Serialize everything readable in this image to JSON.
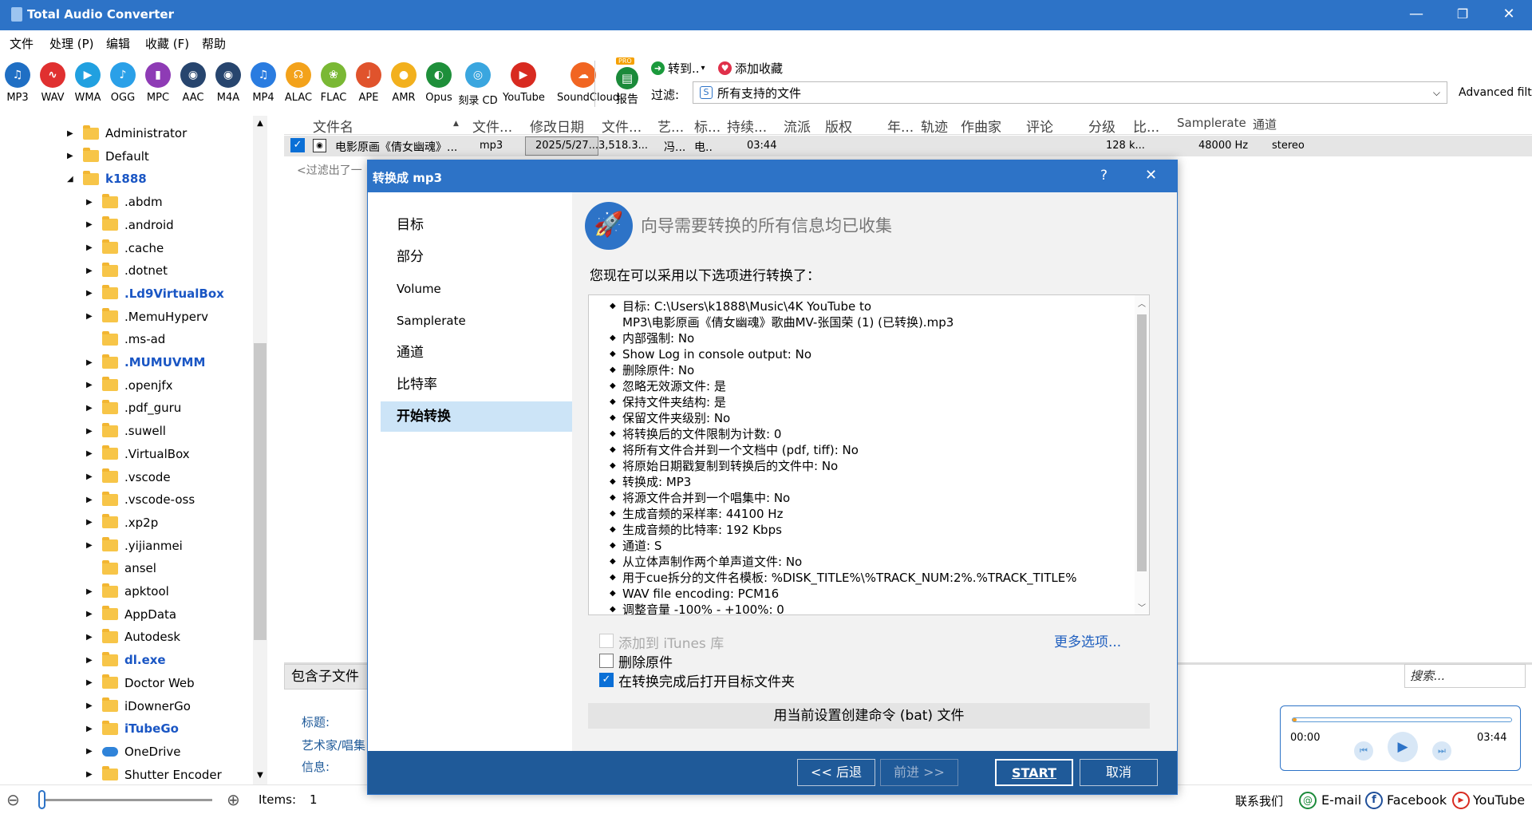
{
  "window": {
    "title": "Total Audio Converter",
    "minimize_glyph": "—",
    "restore_glyph": "❐",
    "close_glyph": "✕"
  },
  "menu": [
    "文件",
    "处理 (P)",
    "编辑",
    "收藏 (F)",
    "帮助"
  ],
  "formats": [
    {
      "label": "MP3",
      "color": "#1f6fc4",
      "glyph": "♫"
    },
    {
      "label": "WAV",
      "color": "#e03030",
      "glyph": "∿"
    },
    {
      "label": "WMA",
      "color": "#21a0e0",
      "glyph": "▶"
    },
    {
      "label": "OGG",
      "color": "#2aa0e8",
      "glyph": "♪"
    },
    {
      "label": "MPC",
      "color": "#8e3bb5",
      "glyph": "▮"
    },
    {
      "label": "AAC",
      "color": "#27456e",
      "glyph": "◉"
    },
    {
      "label": "M4A",
      "color": "#27456e",
      "glyph": "◉"
    },
    {
      "label": "MP4",
      "color": "#2a7ce0",
      "glyph": "♫"
    },
    {
      "label": "ALAC",
      "color": "#f3a21b",
      "glyph": "☊"
    },
    {
      "label": "FLAC",
      "color": "#7ab834",
      "glyph": "❀"
    },
    {
      "label": "APE",
      "color": "#e0532c",
      "glyph": "♩"
    },
    {
      "label": "AMR",
      "color": "#f2b01d",
      "glyph": "●"
    },
    {
      "label": "Opus",
      "color": "#1e8f3a",
      "glyph": "◐"
    },
    {
      "label": "刻录 CD",
      "color": "#3aa6df",
      "glyph": "◎"
    },
    {
      "label": "YouTube",
      "color": "#d82a20",
      "glyph": "▶"
    },
    {
      "label": "SoundCloud",
      "color": "#f16522",
      "glyph": "☁"
    }
  ],
  "toolbar": {
    "report": "报告",
    "pro_badge": "PRO",
    "convert_to": "转到..",
    "convert_arrow": "▾",
    "add_favorite": "添加收藏",
    "filter_label": "过滤:",
    "filter_value": "所有支持的文件",
    "advanced_filter": "Advanced filter"
  },
  "tree": {
    "scroll_up": "▲",
    "scroll_down": "▼",
    "items": [
      {
        "name": "Administrator",
        "level": 1,
        "expandable": true,
        "bold": false
      },
      {
        "name": "Default",
        "level": 1,
        "expandable": true,
        "bold": false
      },
      {
        "name": "k1888",
        "level": 1,
        "expandable": true,
        "expanded": true,
        "bold": true
      },
      {
        "name": ".abdm",
        "level": 2,
        "expandable": true
      },
      {
        "name": ".android",
        "level": 2,
        "expandable": true
      },
      {
        "name": ".cache",
        "level": 2,
        "expandable": true
      },
      {
        "name": ".dotnet",
        "level": 2,
        "expandable": true
      },
      {
        "name": ".Ld9VirtualBox",
        "level": 2,
        "expandable": true,
        "bold": true
      },
      {
        "name": ".MemuHyperv",
        "level": 2,
        "expandable": true
      },
      {
        "name": ".ms-ad",
        "level": 2,
        "expandable": false
      },
      {
        "name": ".MUMUVMM",
        "level": 2,
        "expandable": true,
        "bold": true
      },
      {
        "name": ".openjfx",
        "level": 2,
        "expandable": true
      },
      {
        "name": ".pdf_guru",
        "level": 2,
        "expandable": true
      },
      {
        "name": ".suwell",
        "level": 2,
        "expandable": true
      },
      {
        "name": ".VirtualBox",
        "level": 2,
        "expandable": true
      },
      {
        "name": ".vscode",
        "level": 2,
        "expandable": true
      },
      {
        "name": ".vscode-oss",
        "level": 2,
        "expandable": true
      },
      {
        "name": ".xp2p",
        "level": 2,
        "expandable": true
      },
      {
        "name": ".yijianmei",
        "level": 2,
        "expandable": true
      },
      {
        "name": "ansel",
        "level": 2,
        "expandable": false
      },
      {
        "name": "apktool",
        "level": 2,
        "expandable": true
      },
      {
        "name": "AppData",
        "level": 2,
        "expandable": true
      },
      {
        "name": "Autodesk",
        "level": 2,
        "expandable": true
      },
      {
        "name": "dl.exe",
        "level": 2,
        "expandable": true,
        "bold": true
      },
      {
        "name": "Doctor Web",
        "level": 2,
        "expandable": true
      },
      {
        "name": "iDownerGo",
        "level": 2,
        "expandable": true
      },
      {
        "name": "iTubeGo",
        "level": 2,
        "expandable": true,
        "bold": true
      },
      {
        "name": "OneDrive",
        "level": 2,
        "expandable": true,
        "cloud": true
      },
      {
        "name": "Shutter Encoder",
        "level": 2,
        "expandable": true
      }
    ]
  },
  "filelist": {
    "columns": [
      "文件名",
      "文件...",
      "修改日期",
      "文件...",
      "艺...",
      "标...",
      "持续...",
      "流派",
      "版权",
      "年...",
      "轨迹",
      "作曲家",
      "评论",
      "分级",
      "比...",
      "Samplerate",
      "通道"
    ],
    "sort_arrow": "▲",
    "row": {
      "name": "电影原画《倩女幽魂》...",
      "type": "mp3",
      "date": "2025/5/27...",
      "size": "3,518.3...",
      "artist": "冯...",
      "title": "电..",
      "duration": "03:44",
      "bitrate": "128 k...",
      "samplerate": "48000 Hz",
      "channels": "stereo"
    },
    "filtered_text": "<过滤出了一",
    "include_subfolders": "包含子文件",
    "search_placeholder": "搜索...",
    "meta": {
      "title": "标题:",
      "artist": "艺术家/唱集",
      "info": "信息:"
    }
  },
  "player": {
    "time_start": "00:00",
    "time_end": "03:44",
    "progress": 0.02,
    "prev": "⏮",
    "play": "▶",
    "next": "⏭"
  },
  "dialog": {
    "title": "转换成 mp3",
    "help": "?",
    "close": "✕",
    "nav": [
      "目标",
      "部分",
      "Volume",
      "Samplerate",
      "通道",
      "比特率",
      "开始转换"
    ],
    "active_nav": 6,
    "heading": "向导需要转换的所有信息均已收集",
    "subheading": "您现在可以采用以下选项进行转换了：",
    "summary": [
      "目标: C:\\Users\\k1888\\Music\\4K YouTube to",
      "MP3\\电影原画《倩女幽魂》歌曲MV-张国荣 (1) (已转换).mp3",
      "内部强制: No",
      "Show Log in console output: No",
      "删除原件: No",
      "忽略无效源文件: 是",
      "保持文件夹结构: 是",
      "保留文件夹级别: No",
      "将转换后的文件限制为计数: 0",
      "将所有文件合并到一个文档中 (pdf, tiff): No",
      "将原始日期戳复制到转换后的文件中: No",
      "转换成: MP3",
      "将源文件合并到一个唱集中: No",
      "生成音频的采样率: 44100 Hz",
      "生成音频的比特率: 192 Kbps",
      "通道: S",
      "从立体声制作两个单声道文件: No",
      "用于cue拆分的文件名模板: %DISK_TITLE%\\%TRACK_NUM:2%.%TRACK_TITLE%",
      "WAV file encoding: PCM16",
      "调整音量 -100% - +100%: 0"
    ],
    "add_itunes": "添加到 iTunes 库",
    "more_options": "更多选项...",
    "delete_original": "删除原件",
    "open_folder": "在转换完成后打开目标文件夹",
    "create_bat": "用当前设置创建命令 (bat) 文件",
    "back": "<< 后退",
    "next": "前进 >>",
    "start": "START",
    "cancel": "取消"
  },
  "statusbar": {
    "items_label": "Items:",
    "items_count": "1",
    "contact": "联系我们",
    "email": "E-mail",
    "facebook": "Facebook",
    "youtube": "YouTube",
    "zoom_minus": "⊖",
    "zoom_plus": "⊕"
  }
}
